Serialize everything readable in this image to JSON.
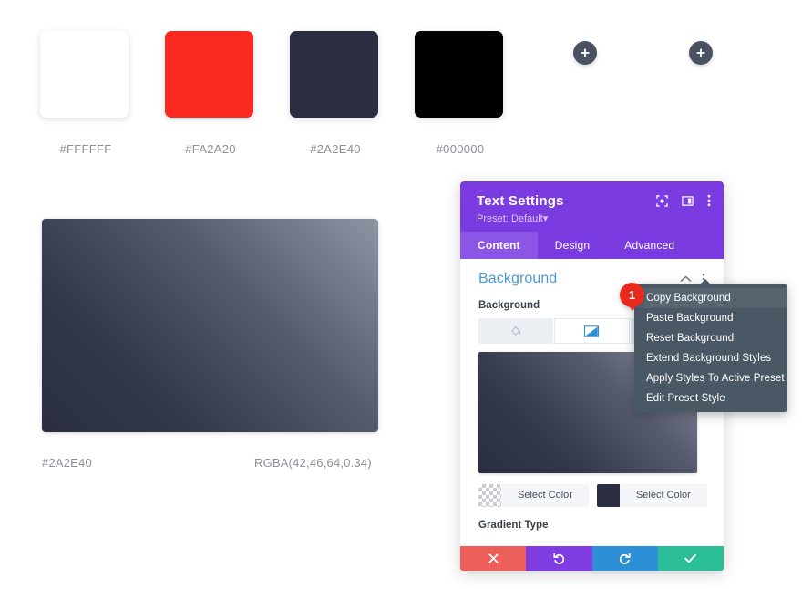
{
  "palette": {
    "swatches": [
      {
        "hex": "#FFFFFF",
        "label": "#FFFFFF",
        "name": "swatch-white"
      },
      {
        "hex": "#FA2A20",
        "label": "#FA2A20",
        "name": "swatch-red"
      },
      {
        "hex": "#2A2E40",
        "label": "#2A2E40",
        "name": "swatch-navy"
      },
      {
        "hex": "#000000",
        "label": "#000000",
        "name": "swatch-black"
      }
    ],
    "add_buttons": [
      {
        "label": "+",
        "name": "add-color-button-1"
      },
      {
        "label": "+",
        "name": "add-color-button-2"
      }
    ]
  },
  "preview": {
    "gradient_from": "#2A2E40",
    "gradient_to": "#8E94A3",
    "caption_left": "#2A2E40",
    "caption_right": "RGBA(42,46,64,0.34)"
  },
  "panel": {
    "title": "Text Settings",
    "preset": "Preset: Default",
    "preset_caret": "▾",
    "header_icons": [
      {
        "name": "focus-target-icon"
      },
      {
        "name": "panel-layout-icon"
      },
      {
        "name": "more-options-icon"
      }
    ],
    "tabs": [
      {
        "label": "Content",
        "active": true
      },
      {
        "label": "Design",
        "active": false
      },
      {
        "label": "Advanced",
        "active": false
      }
    ],
    "section": {
      "title": "Background",
      "collapse_icon": "chevron-up-icon",
      "menu_icon": "kebab-menu-icon"
    },
    "background_field_label": "Background",
    "background_tabs": [
      {
        "name": "background-color-tab",
        "icon": "paint-bucket-icon",
        "active": false
      },
      {
        "name": "background-gradient-tab",
        "icon": "gradient-icon",
        "active": true
      },
      {
        "name": "background-image-tab",
        "icon": "image-icon",
        "active": false
      }
    ],
    "color_stops": [
      {
        "label": "Select Color",
        "swatch": "transparent",
        "name": "gradient-stop-1"
      },
      {
        "label": "Select Color",
        "swatch": "#2A2E40",
        "name": "gradient-stop-2"
      }
    ],
    "gradient_type_label": "Gradient Type",
    "actions": [
      {
        "name": "cancel-button",
        "icon": "close-icon",
        "color": "#EC5F5A"
      },
      {
        "name": "undo-button",
        "icon": "undo-icon",
        "color": "#7E3CE2"
      },
      {
        "name": "redo-button",
        "icon": "redo-icon",
        "color": "#2D8FD5"
      },
      {
        "name": "save-button",
        "icon": "check-icon",
        "color": "#2BBD96"
      }
    ]
  },
  "context_menu": {
    "badge": "1",
    "items": [
      {
        "label": "Copy Background",
        "highlighted": true
      },
      {
        "label": "Paste Background",
        "highlighted": false
      },
      {
        "label": "Reset Background",
        "highlighted": false
      },
      {
        "label": "Extend Background Styles",
        "highlighted": false
      },
      {
        "label": "Apply Styles To Active Preset",
        "highlighted": false
      },
      {
        "label": "Edit Preset Style",
        "highlighted": false
      }
    ]
  }
}
